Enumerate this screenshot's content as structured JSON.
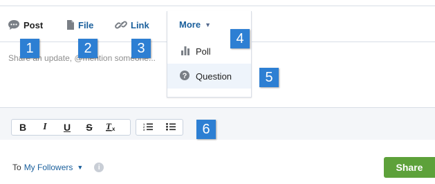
{
  "tabs": {
    "post_label": "Post",
    "file_label": "File",
    "link_label": "Link",
    "more_label": "More"
  },
  "more_menu": {
    "items": [
      {
        "label": "Poll",
        "icon": "bar-chart-icon"
      },
      {
        "label": "Question",
        "icon": "question-icon"
      }
    ]
  },
  "composer": {
    "placeholder_visible": "Share an update, @mention someone..."
  },
  "toolbar": {
    "bold": "B",
    "italic": "I",
    "underline": "U",
    "strike": "S",
    "clear": "Tx"
  },
  "footer": {
    "to_label": "To",
    "audience": "My Followers",
    "share_label": "Share"
  },
  "callouts": [
    "1",
    "2",
    "3",
    "4",
    "5",
    "6"
  ],
  "colors": {
    "link_blue": "#1a5f9c",
    "callout_blue": "#2d7fd3",
    "share_green": "#5da13a",
    "toolbar_bg": "#f4f6f9",
    "selected_item_bg": "#eef4fb"
  }
}
